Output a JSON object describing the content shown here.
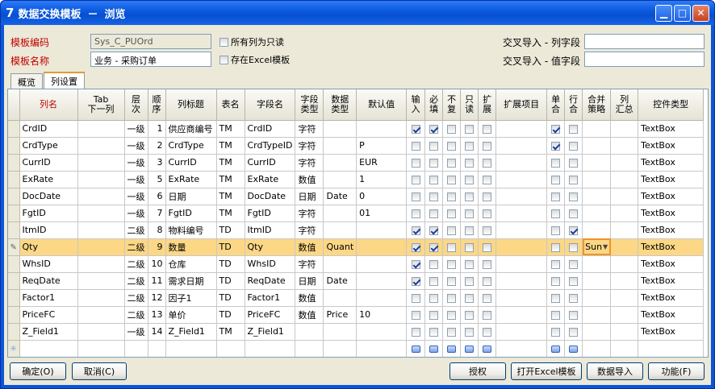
{
  "window": {
    "app_icon": "7",
    "title": "数据交换模板",
    "sep": "－",
    "mode": "浏览",
    "min_glyph": "▁",
    "max_glyph": "□",
    "close_glyph": "✕"
  },
  "form": {
    "code_label": "模板编码",
    "code_value": "Sys_C_PUOrd",
    "name_label": "模板名称",
    "name_value": "业务 - 采购订单",
    "readonly_all_label": "所有列为只读",
    "in_excel_label": "存在Excel模板",
    "cross_col_label": "交叉导入 - 列字段",
    "cross_col_value": "",
    "cross_val_label": "交叉导入 - 值字段",
    "cross_val_value": ""
  },
  "tabs": [
    {
      "label": "概览",
      "active": false
    },
    {
      "label": "列设置",
      "active": true
    }
  ],
  "grid": {
    "headers": {
      "col": "列名",
      "tab1": "Tab",
      "tab2": "下一列",
      "lvl1": "层",
      "lvl2": "次",
      "ord1": "顺",
      "ord2": "序",
      "title": "列标题",
      "table": "表名",
      "field": "字段名",
      "ftype1": "字段",
      "ftype2": "类型",
      "dtype1": "数据",
      "dtype2": "类型",
      "def": "默认值",
      "in1": "输",
      "in2": "入",
      "req1": "必",
      "req2": "填",
      "norep1": "不",
      "norep2": "复",
      "ro1": "只",
      "ro2": "读",
      "ext1": "扩",
      "ext2": "展",
      "extitem": "扩展项目",
      "sm1": "单",
      "sm2": "合",
      "rm1": "行",
      "rm2": "合",
      "ms1": "合并",
      "ms2": "策略",
      "ct1": "列",
      "ct2": "汇总",
      "ctl": "控件类型"
    },
    "rows": [
      {
        "col": "CrdID",
        "tab": "",
        "lvl": "一级",
        "ord": "1",
        "title": "供应商编号",
        "table": "TM",
        "field": "CrdID",
        "ftype": "字符",
        "dtype": "",
        "def": "",
        "in": true,
        "req": true,
        "norep": false,
        "ro": false,
        "ext": false,
        "extitem": "",
        "sm": true,
        "rm": false,
        "ms": "",
        "ct": "",
        "ctl": "TextBox"
      },
      {
        "col": "CrdType",
        "tab": "",
        "lvl": "一级",
        "ord": "2",
        "title": "CrdType",
        "table": "TM",
        "field": "CrdTypeID",
        "ftype": "字符",
        "dtype": "",
        "def": "P",
        "in": false,
        "req": false,
        "norep": false,
        "ro": false,
        "ext": false,
        "extitem": "",
        "sm": true,
        "rm": false,
        "ms": "",
        "ct": "",
        "ctl": "TextBox"
      },
      {
        "col": "CurrID",
        "tab": "",
        "lvl": "一级",
        "ord": "3",
        "title": "CurrID",
        "table": "TM",
        "field": "CurrID",
        "ftype": "字符",
        "dtype": "",
        "def": "EUR",
        "in": false,
        "req": false,
        "norep": false,
        "ro": false,
        "ext": false,
        "extitem": "",
        "sm": false,
        "rm": false,
        "ms": "",
        "ct": "",
        "ctl": "TextBox"
      },
      {
        "col": "ExRate",
        "tab": "",
        "lvl": "一级",
        "ord": "5",
        "title": "ExRate",
        "table": "TM",
        "field": "ExRate",
        "ftype": "数值",
        "dtype": "",
        "def": "1",
        "in": false,
        "req": false,
        "norep": false,
        "ro": false,
        "ext": false,
        "extitem": "",
        "sm": false,
        "rm": false,
        "ms": "",
        "ct": "",
        "ctl": "TextBox"
      },
      {
        "col": "DocDate",
        "tab": "",
        "lvl": "一级",
        "ord": "6",
        "title": "日期",
        "table": "TM",
        "field": "DocDate",
        "ftype": "日期",
        "dtype": "Date",
        "def": "0",
        "in": false,
        "req": false,
        "norep": false,
        "ro": false,
        "ext": false,
        "extitem": "",
        "sm": false,
        "rm": false,
        "ms": "",
        "ct": "",
        "ctl": "TextBox"
      },
      {
        "col": "FgtID",
        "tab": "",
        "lvl": "一级",
        "ord": "7",
        "title": "FgtID",
        "table": "TM",
        "field": "FgtID",
        "ftype": "字符",
        "dtype": "",
        "def": "01",
        "in": false,
        "req": false,
        "norep": false,
        "ro": false,
        "ext": false,
        "extitem": "",
        "sm": false,
        "rm": false,
        "ms": "",
        "ct": "",
        "ctl": "TextBox"
      },
      {
        "col": "ItmID",
        "tab": "",
        "lvl": "二级",
        "ord": "8",
        "title": "物料编号",
        "table": "TD",
        "field": "ItmID",
        "ftype": "字符",
        "dtype": "",
        "def": "",
        "in": true,
        "req": true,
        "norep": false,
        "ro": false,
        "ext": false,
        "extitem": "",
        "sm": false,
        "rm": true,
        "ms": "",
        "ct": "",
        "ctl": "TextBox"
      },
      {
        "col": "Qty",
        "tab": "",
        "lvl": "二级",
        "ord": "9",
        "title": "数量",
        "table": "TD",
        "field": "Qty",
        "ftype": "数值",
        "dtype": "Quant",
        "def": "",
        "in": true,
        "req": true,
        "norep": false,
        "ro": false,
        "ext": false,
        "extitem": "",
        "sm": false,
        "rm": false,
        "ms": "Sun",
        "ct": "",
        "ctl": "TextBox",
        "selected": true
      },
      {
        "col": "WhsID",
        "tab": "",
        "lvl": "二级",
        "ord": "10",
        "title": "仓库",
        "table": "TD",
        "field": "WhsID",
        "ftype": "字符",
        "dtype": "",
        "def": "",
        "in": true,
        "req": false,
        "norep": false,
        "ro": false,
        "ext": false,
        "extitem": "",
        "sm": false,
        "rm": false,
        "ms": "",
        "ct": "",
        "ctl": "TextBox"
      },
      {
        "col": "ReqDate",
        "tab": "",
        "lvl": "二级",
        "ord": "11",
        "title": "需求日期",
        "table": "TD",
        "field": "ReqDate",
        "ftype": "日期",
        "dtype": "Date",
        "def": "",
        "in": true,
        "req": false,
        "norep": false,
        "ro": false,
        "ext": false,
        "extitem": "",
        "sm": false,
        "rm": false,
        "ms": "",
        "ct": "",
        "ctl": "TextBox"
      },
      {
        "col": "Factor1",
        "tab": "",
        "lvl": "二级",
        "ord": "12",
        "title": "因子1",
        "table": "TD",
        "field": "Factor1",
        "ftype": "数值",
        "dtype": "",
        "def": "",
        "in": false,
        "req": false,
        "norep": false,
        "ro": false,
        "ext": false,
        "extitem": "",
        "sm": false,
        "rm": false,
        "ms": "",
        "ct": "",
        "ctl": "TextBox"
      },
      {
        "col": "PriceFC",
        "tab": "",
        "lvl": "二级",
        "ord": "13",
        "title": "单价",
        "table": "TD",
        "field": "PriceFC",
        "ftype": "数值",
        "dtype": "Price",
        "def": "10",
        "in": false,
        "req": false,
        "norep": false,
        "ro": false,
        "ext": false,
        "extitem": "",
        "sm": false,
        "rm": false,
        "ms": "",
        "ct": "",
        "ctl": "TextBox"
      },
      {
        "col": "Z_Field1",
        "tab": "",
        "lvl": "一级",
        "ord": "14",
        "title": "Z_Field1",
        "table": "TM",
        "field": "Z_Field1",
        "ftype": "",
        "dtype": "",
        "def": "",
        "in": false,
        "req": false,
        "norep": false,
        "ro": false,
        "ext": false,
        "extitem": "",
        "sm": false,
        "rm": false,
        "ms": "",
        "ct": "",
        "ctl": "TextBox"
      }
    ],
    "new_row_icon": "✳",
    "edit_icon": "✎",
    "dropdown_icon": "▼"
  },
  "buttons": {
    "ok": "确定(O)",
    "cancel": "取消(C)",
    "auth": "授权",
    "open_excel": "打开Excel模板",
    "import": "数据导入",
    "func": "功能(F)"
  }
}
